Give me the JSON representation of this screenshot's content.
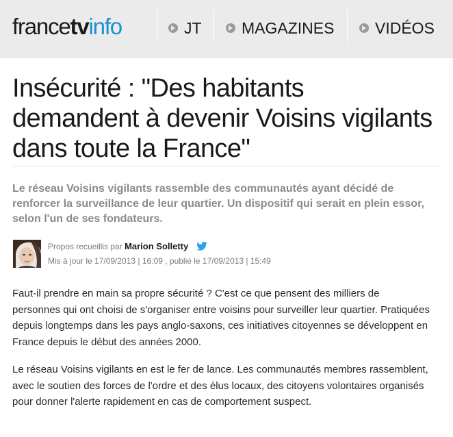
{
  "brand": {
    "part1": "france",
    "part2": "tv",
    "part3": "info"
  },
  "nav": {
    "items": [
      {
        "label": "JT"
      },
      {
        "label": "MAGAZINES"
      },
      {
        "label": "VIDÉOS"
      }
    ]
  },
  "article": {
    "title": "Insécurité : \"Des habitants demandent à devenir Voisins vigilants dans toute la France\"",
    "lead": "Le réseau Voisins vigilants rassemble des communautés ayant décidé de renforcer la surveillance de leur quartier. Un dispositif qui serait en plein essor, selon l'un de ses fondateurs.",
    "byline": {
      "prefix": "Propos recueillis par",
      "author": "Marion Solletty",
      "dates": "Mis à jour le 17/09/2013 | 16:09 , publié le 17/09/2013 | 15:49"
    },
    "paragraphs": [
      "Faut-il prendre en main sa propre sécurité ? C'est ce que pensent des milliers de personnes qui ont choisi de s'organiser entre voisins pour surveiller leur quartier. Pratiquées depuis longtemps dans les pays anglo-saxons, ces initiatives citoyennes se développent en France depuis le début des années 2000.",
      "Le réseau Voisins vigilants en est le fer de lance. Les communautés membres rassemblent, avec le soutien des forces de l'ordre et des élus locaux, des citoyens volontaires organisés pour donner l'alerte rapidement en cas de comportement suspect."
    ]
  },
  "colors": {
    "accent": "#1a8fd3",
    "navbar": "#ebebeb",
    "lead": "#8a8a8a",
    "twitter": "#2aa3ef"
  },
  "icons": {
    "nav_bullet": "circle-arrow-icon",
    "social": "twitter-bird-icon"
  }
}
